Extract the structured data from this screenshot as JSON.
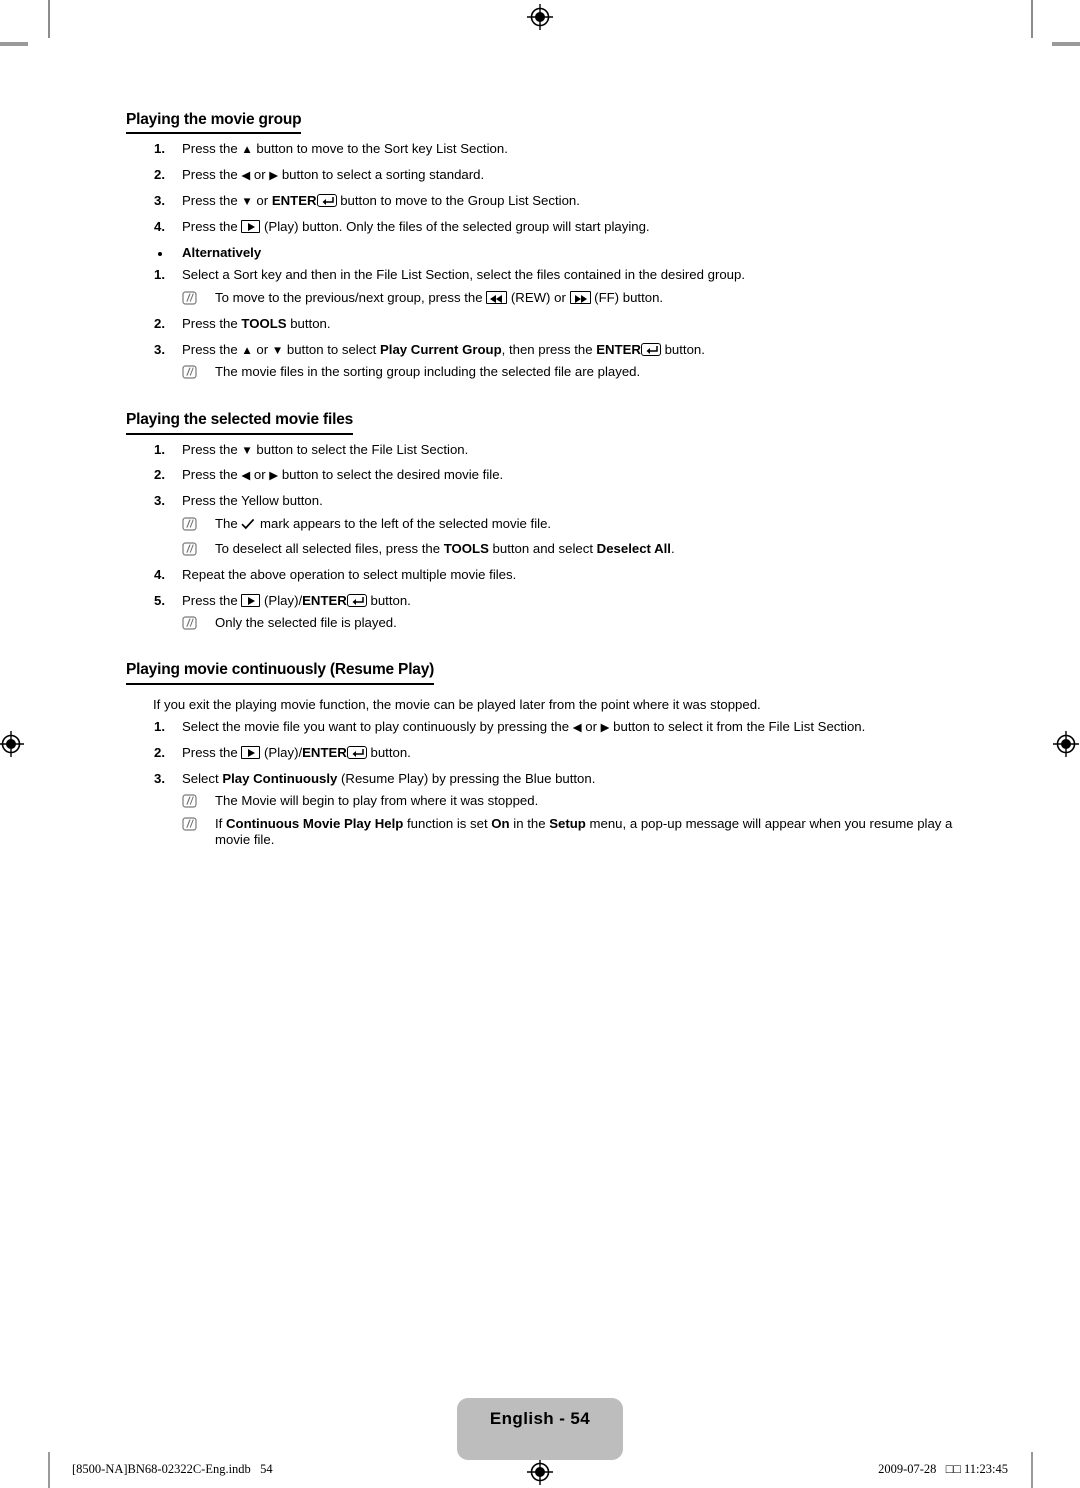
{
  "document": {
    "language_page_label": "English - 54",
    "footer_left": "[8500-NA]BN68-02322C-Eng.indb   54",
    "footer_right": "2009-07-28   □□ 11:23:45"
  },
  "sections": [
    {
      "id": "playing-the-movie-group",
      "title": "Playing the movie group",
      "steps": [
        {
          "num": "1.",
          "parts": [
            {
              "t": "text",
              "v": "Press the "
            },
            {
              "t": "arrow",
              "v": "▲"
            },
            {
              "t": "text",
              "v": " button to move to the Sort key List Section."
            }
          ]
        },
        {
          "num": "2.",
          "parts": [
            {
              "t": "text",
              "v": "Press the "
            },
            {
              "t": "arrow",
              "v": "◀"
            },
            {
              "t": "text",
              "v": " or "
            },
            {
              "t": "arrow",
              "v": "▶"
            },
            {
              "t": "text",
              "v": " button to select a sorting standard."
            }
          ]
        },
        {
          "num": "3.",
          "parts": [
            {
              "t": "text",
              "v": "Press the "
            },
            {
              "t": "arrow",
              "v": "▼"
            },
            {
              "t": "text",
              "v": " or "
            },
            {
              "t": "bold",
              "v": "ENTER"
            },
            {
              "t": "icon",
              "v": "enter-icon"
            },
            {
              "t": "text",
              "v": " button to move to the Group List Section."
            }
          ]
        },
        {
          "num": "4.",
          "parts": [
            {
              "t": "text",
              "v": "Press the "
            },
            {
              "t": "icon",
              "v": "play-icon"
            },
            {
              "t": "text",
              "v": " (Play) button. Only the files of the selected group will start playing."
            }
          ]
        }
      ],
      "bullet": "Alternatively",
      "alt_steps": [
        {
          "num": "1.",
          "parts": [
            {
              "t": "text",
              "v": "Select a Sort key and then in the File List Section, select the files contained in the desired group."
            }
          ],
          "notes": [
            {
              "parts": [
                {
                  "t": "text",
                  "v": "To move to the previous/next group, press the "
                },
                {
                  "t": "icon",
                  "v": "rew-icon"
                },
                {
                  "t": "text",
                  "v": " (REW) or "
                },
                {
                  "t": "icon",
                  "v": "ff-icon"
                },
                {
                  "t": "text",
                  "v": " (FF) button."
                }
              ]
            }
          ]
        },
        {
          "num": "2.",
          "parts": [
            {
              "t": "text",
              "v": "Press the "
            },
            {
              "t": "bold",
              "v": "TOOLS"
            },
            {
              "t": "text",
              "v": " button."
            }
          ]
        },
        {
          "num": "3.",
          "parts": [
            {
              "t": "text",
              "v": "Press the "
            },
            {
              "t": "arrow",
              "v": "▲"
            },
            {
              "t": "text",
              "v": " or "
            },
            {
              "t": "arrow",
              "v": "▼"
            },
            {
              "t": "text",
              "v": " button to select "
            },
            {
              "t": "bold",
              "v": "Play Current Group"
            },
            {
              "t": "text",
              "v": ", then press the "
            },
            {
              "t": "bold",
              "v": "ENTER"
            },
            {
              "t": "icon",
              "v": "enter-icon"
            },
            {
              "t": "text",
              "v": " button."
            }
          ],
          "notes": [
            {
              "parts": [
                {
                  "t": "text",
                  "v": "The movie files in the sorting group including the selected file are played."
                }
              ]
            }
          ]
        }
      ]
    },
    {
      "id": "playing-the-selected-movie-files",
      "title": "Playing the selected movie files",
      "steps": [
        {
          "num": "1.",
          "parts": [
            {
              "t": "text",
              "v": "Press the "
            },
            {
              "t": "arrow",
              "v": "▼"
            },
            {
              "t": "text",
              "v": " button to select the File List Section."
            }
          ]
        },
        {
          "num": "2.",
          "parts": [
            {
              "t": "text",
              "v": "Press the "
            },
            {
              "t": "arrow",
              "v": "◀"
            },
            {
              "t": "text",
              "v": " or "
            },
            {
              "t": "arrow",
              "v": "▶"
            },
            {
              "t": "text",
              "v": " button to select the desired movie file."
            }
          ]
        },
        {
          "num": "3.",
          "parts": [
            {
              "t": "text",
              "v": "Press the Yellow button."
            }
          ],
          "notes": [
            {
              "parts": [
                {
                  "t": "text",
                  "v": "The "
                },
                {
                  "t": "icon",
                  "v": "check-icon"
                },
                {
                  "t": "text",
                  "v": " mark appears to the left of the selected movie file."
                }
              ]
            },
            {
              "parts": [
                {
                  "t": "text",
                  "v": "To deselect all selected files, press the "
                },
                {
                  "t": "bold",
                  "v": "TOOLS"
                },
                {
                  "t": "text",
                  "v": " button and select "
                },
                {
                  "t": "bold",
                  "v": "Deselect All"
                },
                {
                  "t": "text",
                  "v": "."
                }
              ]
            }
          ]
        },
        {
          "num": "4.",
          "parts": [
            {
              "t": "text",
              "v": "Repeat the above operation to select multiple movie files."
            }
          ]
        },
        {
          "num": "5.",
          "parts": [
            {
              "t": "text",
              "v": "Press the "
            },
            {
              "t": "icon",
              "v": "play-icon"
            },
            {
              "t": "text",
              "v": " (Play)/"
            },
            {
              "t": "bold",
              "v": "ENTER"
            },
            {
              "t": "icon",
              "v": "enter-icon"
            },
            {
              "t": "text",
              "v": " button."
            }
          ],
          "notes": [
            {
              "parts": [
                {
                  "t": "text",
                  "v": "Only the selected file is played."
                }
              ]
            }
          ]
        }
      ]
    },
    {
      "id": "playing-movie-continuously",
      "title": "Playing movie continuously (Resume Play)",
      "intro": "If you exit the playing movie function, the movie can be played later from the point where it was stopped.",
      "steps": [
        {
          "num": "1.",
          "parts": [
            {
              "t": "text",
              "v": "Select the movie file you want to play continuously by pressing the "
            },
            {
              "t": "arrow",
              "v": "◀"
            },
            {
              "t": "text",
              "v": " or "
            },
            {
              "t": "arrow",
              "v": "▶"
            },
            {
              "t": "text",
              "v": " button to select it from the File List Section."
            }
          ]
        },
        {
          "num": "2.",
          "parts": [
            {
              "t": "text",
              "v": "Press the "
            },
            {
              "t": "icon",
              "v": "play-icon"
            },
            {
              "t": "text",
              "v": " (Play)/"
            },
            {
              "t": "bold",
              "v": "ENTER"
            },
            {
              "t": "icon",
              "v": "enter-icon"
            },
            {
              "t": "text",
              "v": " button."
            }
          ]
        },
        {
          "num": "3.",
          "parts": [
            {
              "t": "text",
              "v": "Select "
            },
            {
              "t": "bold",
              "v": "Play Continuously"
            },
            {
              "t": "text",
              "v": " (Resume Play) by pressing the Blue button."
            }
          ],
          "notes": [
            {
              "parts": [
                {
                  "t": "text",
                  "v": "The Movie will begin to play from where it was stopped."
                }
              ]
            },
            {
              "parts": [
                {
                  "t": "text",
                  "v": "If "
                },
                {
                  "t": "bold",
                  "v": "Continuous Movie Play Help"
                },
                {
                  "t": "text",
                  "v": " function is set "
                },
                {
                  "t": "bold",
                  "v": "On"
                },
                {
                  "t": "text",
                  "v": " in the "
                },
                {
                  "t": "bold",
                  "v": "Setup"
                },
                {
                  "t": "text",
                  "v": " menu, a pop-up message will appear when you resume play a movie file."
                }
              ]
            }
          ]
        }
      ]
    }
  ],
  "colors": {
    "page_tab_bg": "#bdbdbd",
    "text": "#000000",
    "crop_mark": "#9a9a9a"
  }
}
